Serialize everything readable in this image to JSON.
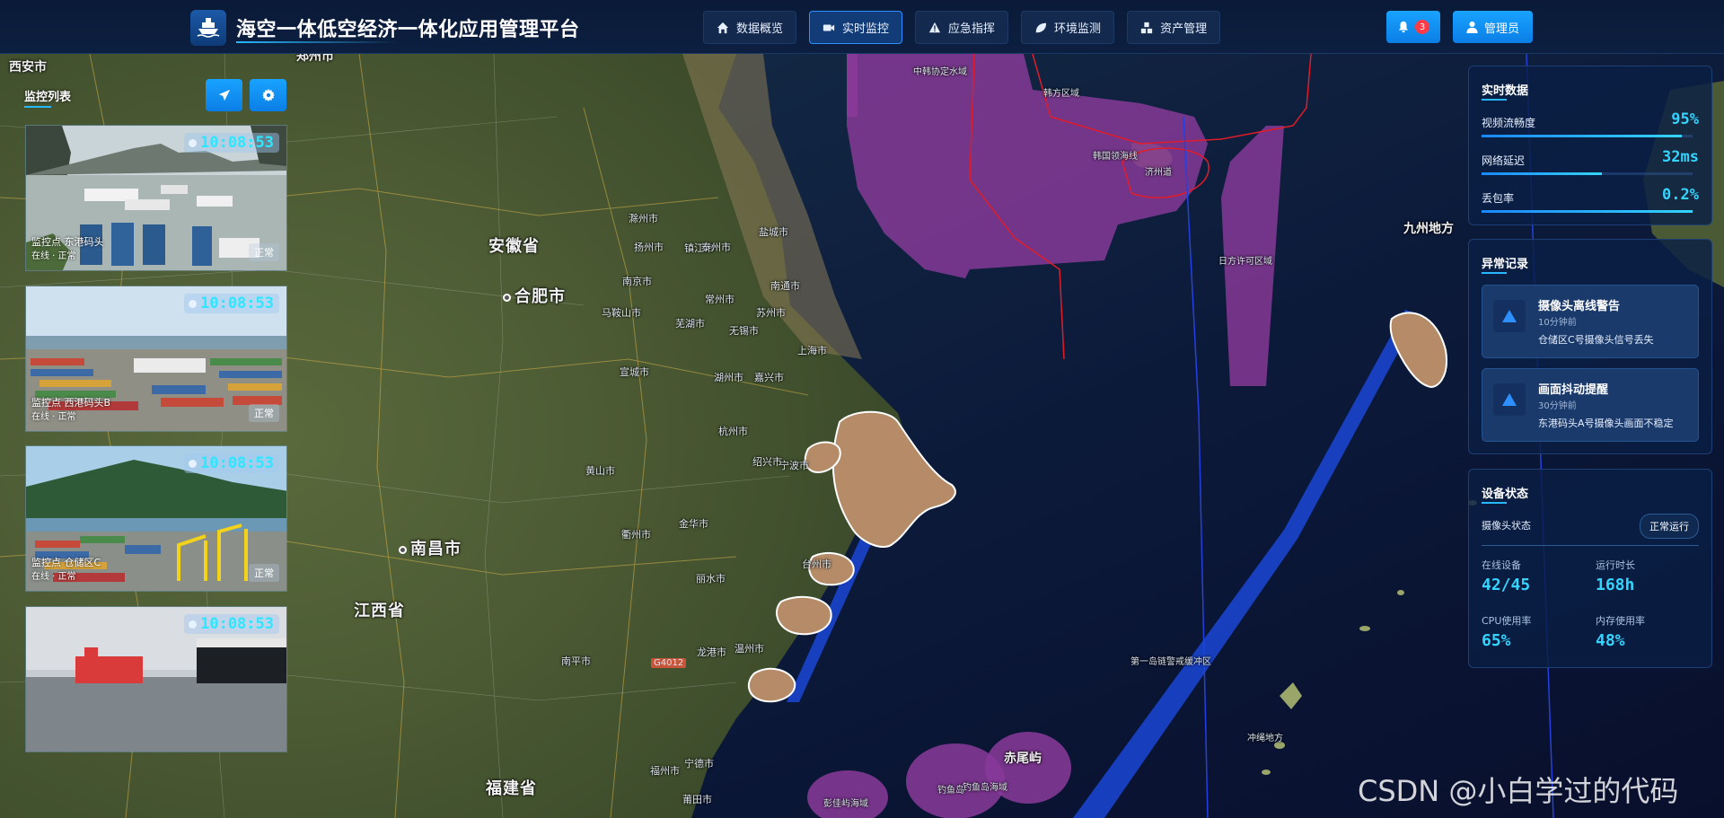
{
  "header": {
    "app_title": "海空一体低空经济一体化应用管理平台",
    "nav": [
      {
        "label": "数据概览",
        "icon": "home-icon"
      },
      {
        "label": "实时监控",
        "icon": "video-icon"
      },
      {
        "label": "应急指挥",
        "icon": "warning-icon"
      },
      {
        "label": "环境监测",
        "icon": "leaf-icon"
      },
      {
        "label": "资产管理",
        "icon": "boxes-icon"
      }
    ],
    "active_nav": "实时监控",
    "notification_count": "3",
    "admin_label": "管理员"
  },
  "left_panel": {
    "title": "监控列表",
    "cameras": [
      {
        "time": "10:08:53",
        "caption": "监控点 东港码头",
        "sub": "在线 · 正常",
        "status": "正常"
      },
      {
        "time": "10:08:53",
        "caption": "监控点 西港码头B",
        "sub": "在线 · 正常",
        "status": "正常"
      },
      {
        "time": "10:08:53",
        "caption": "监控点 仓储区C",
        "sub": "在线 · 正常",
        "status": "正常"
      },
      {
        "time": "10:08:53",
        "caption": "",
        "sub": "",
        "status": ""
      }
    ]
  },
  "realtime": {
    "title": "实时数据",
    "metrics": [
      {
        "label": "视频流畅度",
        "value": "95%",
        "level": 0.95
      },
      {
        "label": "网络延迟",
        "value": "32ms",
        "level": 0.57
      },
      {
        "label": "丢包率",
        "value": "0.2%",
        "level": 1.0
      }
    ]
  },
  "alerts": {
    "title": "异常记录",
    "items": [
      {
        "title": "摄像头离线警告",
        "time": "10分钟前",
        "desc": "仓储区C号摄像头信号丢失"
      },
      {
        "title": "画面抖动提醒",
        "time": "30分钟前",
        "desc": "东港码头A号摄像头画面不稳定"
      }
    ]
  },
  "device": {
    "title": "设备状态",
    "camera_status_label": "摄像头状态",
    "camera_status_value": "正常运行",
    "stats": [
      {
        "label": "在线设备",
        "value": "42/45"
      },
      {
        "label": "运行时长",
        "value": "168h"
      },
      {
        "label": "CPU使用率",
        "value": "65%"
      },
      {
        "label": "内存使用率",
        "value": "48%"
      }
    ]
  },
  "map_labels": {
    "provinces": [
      "安徽省",
      "江西省",
      "福建省"
    ],
    "big_cities": [
      "合肥市",
      "南昌市"
    ],
    "regions": [
      "九州地方",
      "赤尾屿",
      "西安市",
      "郑州市"
    ],
    "small": [
      "中韩协定水域",
      "韩方区域",
      "韩国领海线",
      "济州道",
      "日方许可区域",
      "第一岛链警戒缓冲区",
      "冲绳地方",
      "彭佳屿海域",
      "钓鱼岛海域",
      "钓鱼岛",
      "上海市",
      "杭州市",
      "南京市",
      "宁波市",
      "苏州市",
      "无锡市",
      "常州市",
      "南通市",
      "镇江市",
      "扬州市",
      "泰州市",
      "盐城市",
      "湖州市",
      "嘉兴市",
      "绍兴市",
      "台州市",
      "温州市",
      "金华市",
      "衢州市",
      "丽水市",
      "黄山市",
      "宣城市",
      "芜湖市",
      "马鞍山市",
      "滁州市",
      "南平市",
      "宁德市",
      "福州市",
      "莆田市",
      "龙港市",
      "G4012"
    ]
  },
  "watermark": "CSDN @小白学过的代码"
}
